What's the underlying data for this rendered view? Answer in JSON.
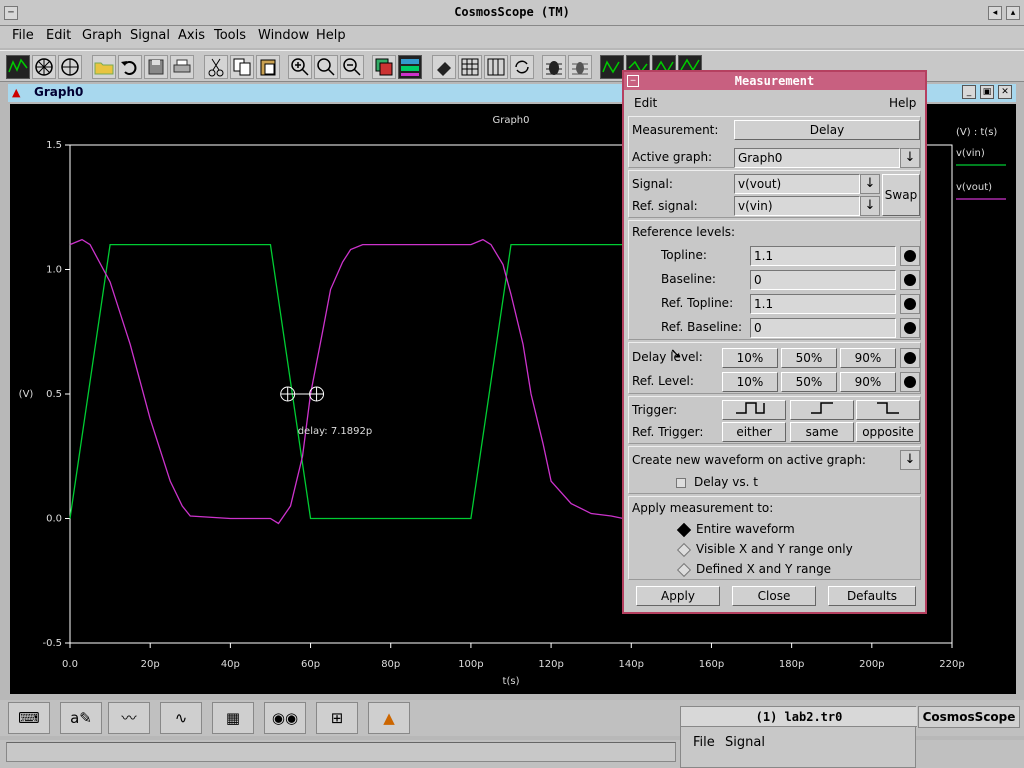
{
  "app": {
    "title": "CosmosScope (TM)"
  },
  "menu": [
    "File",
    "Edit",
    "Graph",
    "Signal",
    "Axis",
    "Tools",
    "Window",
    "Help"
  ],
  "graph_window": {
    "name": "Graph0"
  },
  "chart_data": {
    "type": "line",
    "title": "Graph0",
    "xlabel": "t(s)",
    "ylabel": "(V)",
    "xlim": [
      0,
      220
    ],
    "ylim": [
      -0.5,
      1.5
    ],
    "x_ticks": [
      "0.0",
      "20p",
      "40p",
      "60p",
      "80p",
      "100p",
      "120p",
      "140p",
      "160p",
      "180p",
      "200p",
      "220p"
    ],
    "y_ticks": [
      "1.5",
      "1.0",
      "0.5",
      "0.0",
      "-0.5"
    ],
    "legend_header": "(V) : t(s)",
    "series": [
      {
        "name": "v(vin)",
        "color": "#00cc33",
        "x": [
          0,
          10,
          50,
          60,
          100,
          110,
          150
        ],
        "y": [
          0,
          1.1,
          1.1,
          0,
          0,
          1.1,
          1.1
        ]
      },
      {
        "name": "v(vout)",
        "color": "#cc33cc",
        "x": [
          0,
          3,
          5,
          10,
          15,
          20,
          25,
          28,
          30,
          40,
          50,
          52,
          55,
          58,
          60,
          63,
          65,
          68,
          70,
          73,
          75,
          80,
          100,
          103,
          105,
          108,
          110,
          113,
          115,
          118,
          120,
          125,
          130,
          135,
          138,
          140
        ],
        "y": [
          1.1,
          1.12,
          1.1,
          0.95,
          0.7,
          0.4,
          0.15,
          0.05,
          0.01,
          0.0,
          0.0,
          -0.02,
          0.05,
          0.25,
          0.5,
          0.75,
          0.92,
          1.03,
          1.08,
          1.1,
          1.1,
          1.1,
          1.1,
          1.12,
          1.1,
          1.02,
          0.9,
          0.7,
          0.5,
          0.3,
          0.15,
          0.06,
          0.02,
          0.01,
          0.0,
          0.0
        ]
      }
    ],
    "annotation": "delay: 7.1892p"
  },
  "measurement": {
    "title": "Measurement",
    "menu_edit": "Edit",
    "menu_help": "Help",
    "measurement_label": "Measurement:",
    "measurement_value": "Delay",
    "active_graph_label": "Active graph:",
    "active_graph_value": "Graph0",
    "signal_label": "Signal:",
    "signal_value": "v(vout)",
    "ref_signal_label": "Ref. signal:",
    "ref_signal_value": "v(vin)",
    "swap": "Swap",
    "ref_levels_label": "Reference levels:",
    "topline_label": "Topline:",
    "topline_value": "1.1",
    "baseline_label": "Baseline:",
    "baseline_value": "0",
    "ref_topline_label": "Ref. Topline:",
    "ref_topline_value": "1.1",
    "ref_baseline_label": "Ref. Baseline:",
    "ref_baseline_value": "0",
    "delay_level_label": "Delay level:",
    "ref_level_label": "Ref. Level:",
    "pct": [
      "10%",
      "50%",
      "90%"
    ],
    "trigger_label": "Trigger:",
    "ref_trigger_label": "Ref. Trigger:",
    "ref_trigger_options": [
      "either",
      "same",
      "opposite"
    ],
    "create_label": "Create new waveform on active graph:",
    "delay_vs_t": "Delay vs. t",
    "apply_to_label": "Apply measurement to:",
    "apply_options": [
      "Entire waveform",
      "Visible X and Y range only",
      "Defined X and Y range"
    ],
    "apply_button": "Apply",
    "close_button": "Close",
    "defaults_button": "Defaults"
  },
  "dock": {
    "cosmos_label": "CosmosScope"
  },
  "lab2": {
    "title": "(1) lab2.tr0",
    "menu_file": "File",
    "menu_signal": "Signal"
  }
}
